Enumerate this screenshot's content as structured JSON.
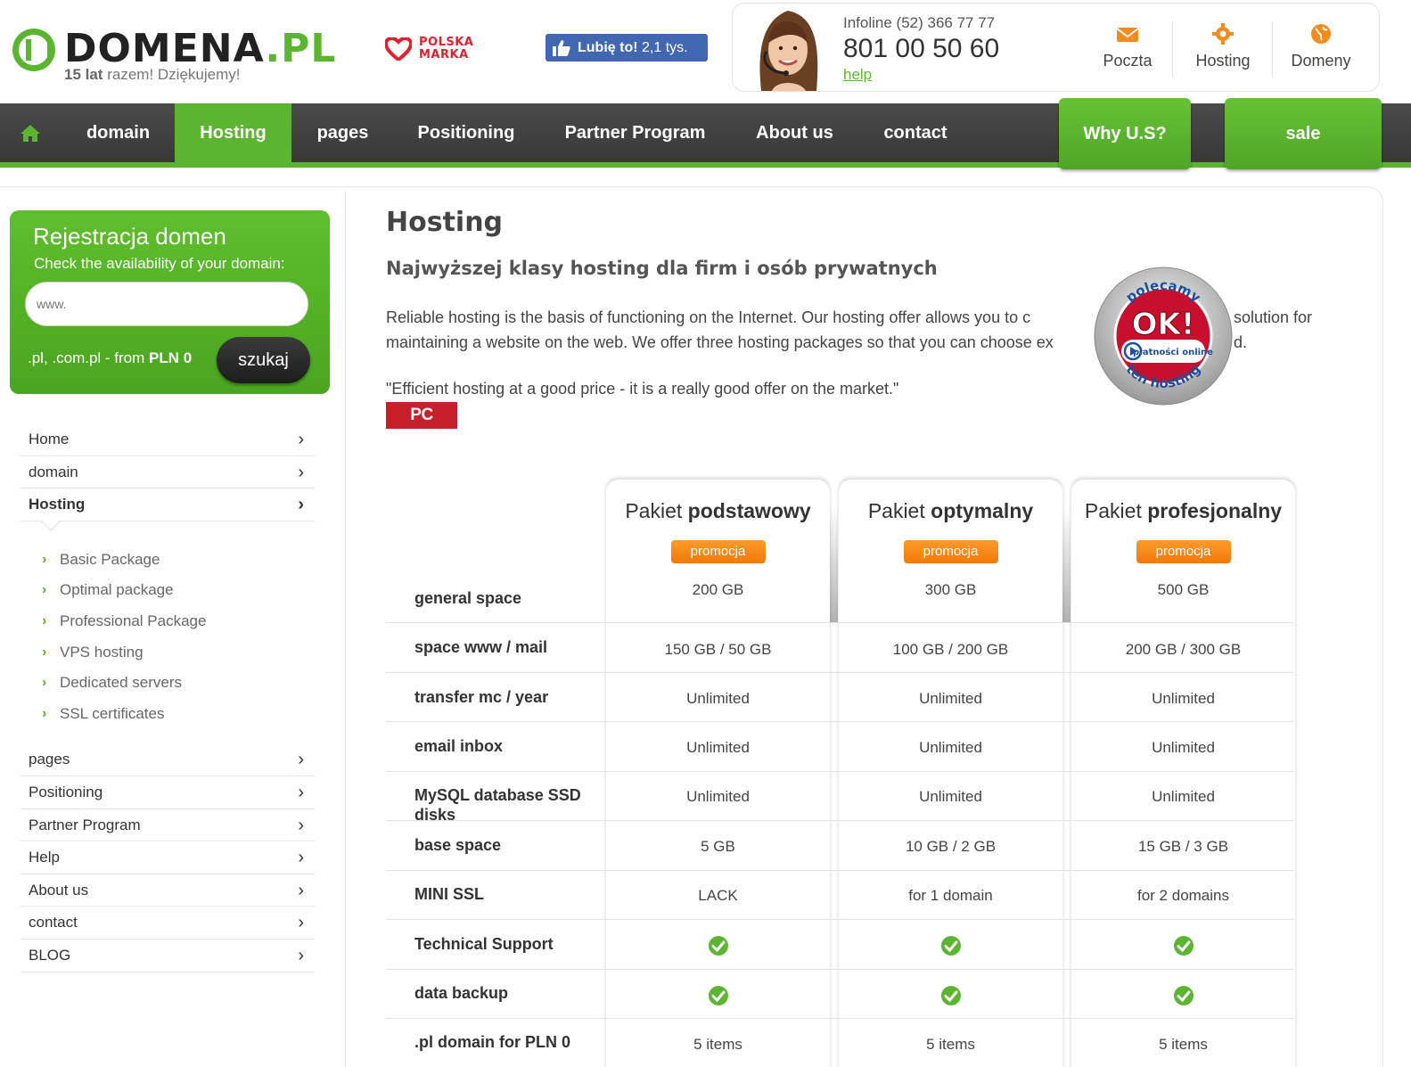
{
  "header": {
    "logo_word": "DOMENA",
    "logo_tld": ".PL",
    "logo_tagline_bold": "15 lat",
    "logo_tagline_rest": " razem! Dziękujemy!",
    "polska_marka": "POLSKA MARKA",
    "fb_like_label": "Lubię to!",
    "fb_like_count": "2,1 tys.",
    "infoline": "Infoline (52) 366 77 77",
    "phone": "801 00 50 60",
    "help": "help",
    "quick_links": [
      {
        "label": "Poczta",
        "icon": "envelope-icon"
      },
      {
        "label": "Hosting",
        "icon": "gear-icon"
      },
      {
        "label": "Domeny",
        "icon": "globe-icon"
      }
    ]
  },
  "nav": {
    "items": [
      "domain",
      "Hosting",
      "pages",
      "Positioning",
      "Partner Program",
      "About us",
      "contact"
    ],
    "active": "Hosting",
    "why_us": "Why U.S?",
    "sale": "sale"
  },
  "sidebar": {
    "domain_box": {
      "title": "Rejestracja domen",
      "subtitle": "Check the availability of your domain:",
      "input_placeholder": "www.",
      "promo_text": ".pl, .com.pl - from ",
      "promo_price": "PLN 0",
      "search_button": "szukaj"
    },
    "menu_top": [
      "Home",
      "domain",
      "Hosting"
    ],
    "submenu": [
      "Basic Package",
      "Optimal package",
      "Professional Package",
      "VPS hosting",
      "Dedicated servers",
      "SSL certificates"
    ],
    "menu_bottom": [
      "pages",
      "Positioning",
      "Partner Program",
      "Help",
      "About us",
      "contact",
      "BLOG"
    ]
  },
  "main": {
    "title": "Hosting",
    "subtitle": "Najwyższej klasy hosting dla firm i osób prywatnych",
    "para_line1_a": "Reliable hosting is the basis of functioning on the Internet. Our hosting offer allows you to c",
    "para_line1_b": "solution for",
    "para_line2_a": "maintaining a website on the web. We offer three hosting packages so that you can choose ex",
    "para_line2_b": "d.",
    "quote": "\"Efficient hosting at a good price - it is a really good offer on the market.\"",
    "pcworld": "PC WORLD",
    "badge": {
      "top": "polecamy",
      "center": "OK!",
      "brand": "płatności online",
      "bottom": "ten hosting"
    }
  },
  "packages": [
    {
      "prefix": "Pakiet ",
      "name": "podstawowy",
      "promo": "promocja"
    },
    {
      "prefix": "Pakiet ",
      "name": "optymalny",
      "promo": "promocja"
    },
    {
      "prefix": "Pakiet ",
      "name": "profesjonalny",
      "promo": "promocja"
    }
  ],
  "table_rows": [
    {
      "label": "general space",
      "values": [
        "200 GB",
        "300 GB",
        "500 GB"
      ]
    },
    {
      "label": "space www / mail",
      "values": [
        "150 GB / 50 GB",
        "100 GB / 200 GB",
        "200 GB / 300 GB"
      ]
    },
    {
      "label": "transfer mc / year",
      "values": [
        "Unlimited",
        "Unlimited",
        "Unlimited"
      ]
    },
    {
      "label": "email inbox",
      "values": [
        "Unlimited",
        "Unlimited",
        "Unlimited"
      ]
    },
    {
      "label": "MySQL database SSD disks",
      "values": [
        "Unlimited",
        "Unlimited",
        "Unlimited"
      ]
    },
    {
      "label": "base space",
      "values": [
        "5 GB",
        "10 GB / 2 GB",
        "15 GB / 3 GB"
      ]
    },
    {
      "label": "MINI SSL",
      "values": [
        "LACK",
        "for 1 domain",
        "for 2 domains"
      ]
    },
    {
      "label": "Technical Support",
      "values": [
        true,
        true,
        true
      ]
    },
    {
      "label": "data backup",
      "values": [
        true,
        true,
        true
      ]
    },
    {
      "label": ".pl domain for PLN 0",
      "values": [
        "5 items",
        "5 items",
        "5 items"
      ]
    }
  ],
  "colors": {
    "brand_green": "#5cb531",
    "nav_dark": "#404040",
    "promo_orange": "#f58a1f",
    "pcworld_red": "#c51f2a"
  }
}
